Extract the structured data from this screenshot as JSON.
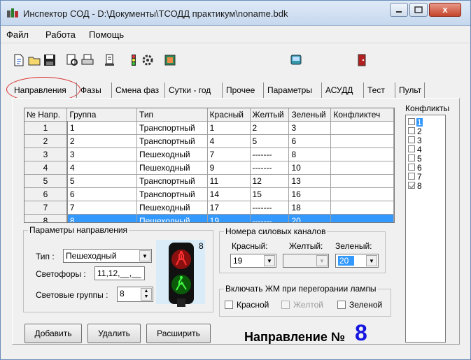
{
  "window": {
    "title": "Инспектор СОД - D:\\Документы\\ТСОДД практикум\\noname.bdk",
    "close_label": "x"
  },
  "menu": [
    "Файл",
    "Работа",
    "Помощь"
  ],
  "toolbar": [
    "new-file-icon",
    "open-folder-icon",
    "save-icon",
    "print-preview-icon",
    "print-icon",
    "report-icon",
    "traffic-light-icon",
    "settings-icon",
    "table-icon",
    "notebook-icon",
    "exit-door-icon"
  ],
  "tabs": [
    "Направления",
    "Фазы",
    "Смена фаз",
    "Сутки - год",
    "Прочее",
    "Параметры",
    "АСУДД",
    "Тест",
    "Пульт"
  ],
  "grid": {
    "headers": [
      "№ Напр.",
      "Группа",
      "Тип",
      "Красный",
      "Желтый",
      "Зеленый",
      "Конфликтеч"
    ],
    "rows": [
      [
        "1",
        "1",
        "Транспортный",
        "1",
        "2",
        "3",
        ""
      ],
      [
        "2",
        "2",
        "Транспортный",
        "4",
        "5",
        "6",
        ""
      ],
      [
        "3",
        "3",
        "Пешеходный",
        "7",
        "-------",
        "8",
        ""
      ],
      [
        "4",
        "4",
        "Пешеходный",
        "9",
        "-------",
        "10",
        ""
      ],
      [
        "5",
        "5",
        "Транспортный",
        "11",
        "12",
        "13",
        ""
      ],
      [
        "6",
        "6",
        "Транспортный",
        "14",
        "15",
        "16",
        ""
      ],
      [
        "7",
        "7",
        "Пешеходный",
        "17",
        "-------",
        "18",
        ""
      ],
      [
        "8",
        "8",
        "Пешеходный",
        "19",
        "-------",
        "20",
        ""
      ]
    ],
    "selected_row": 7
  },
  "conflicts": {
    "title": "Конфликты",
    "items": [
      {
        "label": "1",
        "checked": false
      },
      {
        "label": "2",
        "checked": false
      },
      {
        "label": "3",
        "checked": false
      },
      {
        "label": "4",
        "checked": false
      },
      {
        "label": "5",
        "checked": false
      },
      {
        "label": "6",
        "checked": false
      },
      {
        "label": "7",
        "checked": false
      },
      {
        "label": "8",
        "checked": true
      }
    ]
  },
  "params": {
    "title": "Параметры направления",
    "type_label": "Тип :",
    "type_value": "Пешеходный",
    "lights_label": "Светофоры :",
    "lights_value": "11,12,__,__",
    "groups_label": "Световые группы :",
    "groups_value": "8",
    "preview_number": "8"
  },
  "channels": {
    "title": "Номера силовых каналов",
    "red_label": "Красный:",
    "yellow_label": "Желтый:",
    "green_label": "Зеленый:",
    "red_value": "19",
    "yellow_value": "",
    "green_value": "20"
  },
  "lamp": {
    "title": "Включать ЖМ при перегорании лампы",
    "red": "Красной",
    "yellow": "Желтой",
    "green": "Зеленой"
  },
  "buttons": {
    "add": "Добавить",
    "delete": "Удалить",
    "expand": "Расширить"
  },
  "direction": {
    "label": "Направление №",
    "number": "8"
  },
  "colors": {
    "selection": "#3399ff",
    "number_blue": "#1515e0",
    "highlight_oval": "#d82a2a"
  }
}
